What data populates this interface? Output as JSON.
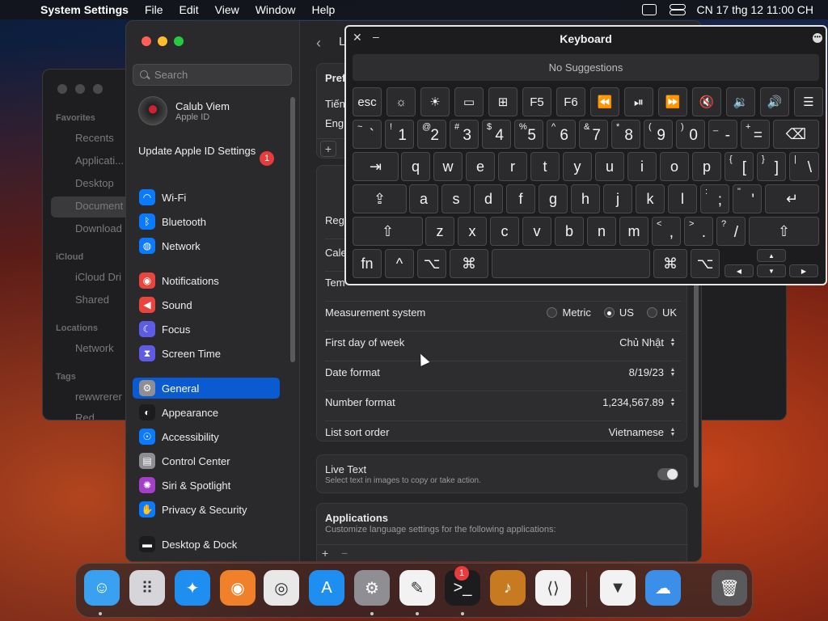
{
  "menubar": {
    "app_name": "System Settings",
    "menus": [
      "File",
      "Edit",
      "View",
      "Window",
      "Help"
    ],
    "clock": "CN 17 thg 12  11:00 CH"
  },
  "finder": {
    "favorites_label": "Favorites",
    "favorites": [
      "Recents",
      "Applicati...",
      "Desktop",
      "Document",
      "Download"
    ],
    "icloud_label": "iCloud",
    "icloud": [
      "iCloud Dri",
      "Shared"
    ],
    "locations_label": "Locations",
    "locations": [
      "Network"
    ],
    "tags_label": "Tags",
    "tags": [
      "rewwrerer",
      "Red"
    ]
  },
  "sidebar": {
    "search_placeholder": "Search",
    "user_name": "Calub Viem",
    "user_sub": "Apple ID",
    "update_label": "Update Apple ID Settings",
    "update_badge": "1",
    "items": [
      {
        "label": "Wi-Fi",
        "icon": "wifi-icon",
        "color": "#0a7aff"
      },
      {
        "label": "Bluetooth",
        "icon": "bluetooth-icon",
        "color": "#0a7aff"
      },
      {
        "label": "Network",
        "icon": "globe-icon",
        "color": "#0a7aff"
      },
      {
        "label": "Notifications",
        "icon": "bell-icon",
        "color": "#e8453c"
      },
      {
        "label": "Sound",
        "icon": "speaker-icon",
        "color": "#e8453c"
      },
      {
        "label": "Focus",
        "icon": "moon-icon",
        "color": "#5e5ce6"
      },
      {
        "label": "Screen Time",
        "icon": "hourglass-icon",
        "color": "#5e5ce6"
      },
      {
        "label": "General",
        "icon": "gear-icon",
        "color": "#8e8e93"
      },
      {
        "label": "Appearance",
        "icon": "appearance-icon",
        "color": "#1c1c1e"
      },
      {
        "label": "Accessibility",
        "icon": "accessibility-icon",
        "color": "#0a7aff"
      },
      {
        "label": "Control Center",
        "icon": "control-center-icon",
        "color": "#8e8e93"
      },
      {
        "label": "Siri & Spotlight",
        "icon": "siri-icon",
        "color": "#a440c8"
      },
      {
        "label": "Privacy & Security",
        "icon": "hand-icon",
        "color": "#0a7aff"
      },
      {
        "label": "Desktop & Dock",
        "icon": "dock-icon",
        "color": "#1c1c1e"
      }
    ]
  },
  "content": {
    "pref_header": "Pref",
    "lang_rows": [
      "Tiến",
      "Engl"
    ],
    "partial_rows": [
      "Regi",
      "Cale",
      "Tem"
    ],
    "measurement_label": "Measurement system",
    "measurement_options": [
      "Metric",
      "US",
      "UK"
    ],
    "measurement_selected": "US",
    "first_day_label": "First day of week",
    "first_day_value": "Chủ Nhật",
    "date_format_label": "Date format",
    "date_format_value": "8/19/23",
    "number_format_label": "Number format",
    "number_format_value": "1,234,567.89",
    "sort_order_label": "List sort order",
    "sort_order_value": "Vietnamese",
    "live_text_label": "Live Text",
    "live_text_desc": "Select text in images to copy or take action.",
    "apps_label": "Applications",
    "apps_desc": "Customize language settings for the following applications:",
    "plus": "+",
    "minus": "−",
    "back_letter": "L"
  },
  "keyboard": {
    "title": "Keyboard",
    "suggestions": "No Suggestions",
    "row0": [
      "esc",
      "☼",
      "☀",
      "▭",
      "⊞",
      "F5",
      "F6",
      "⏪",
      "⏯",
      "⏩",
      "🔇",
      "🔉",
      "🔊",
      "☰"
    ],
    "row1": [
      {
        "top": "~",
        "main": "`"
      },
      {
        "top": "!",
        "main": "1"
      },
      {
        "top": "@",
        "main": "2"
      },
      {
        "top": "#",
        "main": "3"
      },
      {
        "top": "$",
        "main": "4"
      },
      {
        "top": "%",
        "main": "5"
      },
      {
        "top": "^",
        "main": "6"
      },
      {
        "top": "&",
        "main": "7"
      },
      {
        "top": "*",
        "main": "8"
      },
      {
        "top": "(",
        "main": "9"
      },
      {
        "top": ")",
        "main": "0"
      },
      {
        "top": "_",
        "main": "-"
      },
      {
        "top": "+",
        "main": "="
      }
    ],
    "delete": "⌫",
    "tab": "⇥",
    "row2": [
      "q",
      "w",
      "e",
      "r",
      "t",
      "y",
      "u",
      "i",
      "o",
      "p"
    ],
    "row2_extra": [
      {
        "top": "{",
        "main": "["
      },
      {
        "top": "}",
        "main": "]"
      },
      {
        "top": "|",
        "main": "\\"
      }
    ],
    "caps": "⇪",
    "row3": [
      "a",
      "s",
      "d",
      "f",
      "g",
      "h",
      "j",
      "k",
      "l"
    ],
    "row3_extra": [
      {
        "top": ":",
        "main": ";"
      },
      {
        "top": "\"",
        "main": "'"
      }
    ],
    "return": "↵",
    "shift": "⇧",
    "row4": [
      "z",
      "x",
      "c",
      "v",
      "b",
      "n",
      "m"
    ],
    "row4_extra": [
      {
        "top": "<",
        "main": ","
      },
      {
        "top": ">",
        "main": "."
      },
      {
        "top": "?",
        "main": "/"
      }
    ],
    "fn": "fn",
    "ctrl": "^",
    "option": "⌥",
    "cmd": "⌘",
    "arrow_up": "▲",
    "arrow_down": "▼",
    "arrow_left": "◀",
    "arrow_right": "▶"
  },
  "dock": {
    "settings_badge": "1",
    "apps": [
      {
        "name": "finder",
        "color": "#3aa0f0",
        "glyph": "☺"
      },
      {
        "name": "launchpad",
        "color": "#d6d6da",
        "glyph": "⠿"
      },
      {
        "name": "safari",
        "color": "#1e8ff0",
        "glyph": "✦"
      },
      {
        "name": "firefox",
        "color": "#f0802a",
        "glyph": "◉"
      },
      {
        "name": "chrome",
        "color": "#e8e8e8",
        "glyph": "◎"
      },
      {
        "name": "app-store",
        "color": "#1e8ff0",
        "glyph": "A"
      },
      {
        "name": "system-settings",
        "color": "#8e8e93",
        "glyph": "⚙"
      },
      {
        "name": "textedit",
        "color": "#f2f2f2",
        "glyph": "✎"
      },
      {
        "name": "terminal",
        "color": "#1c1c1e",
        "glyph": ">_"
      },
      {
        "name": "instruments",
        "color": "#c87a20",
        "glyph": "♪"
      },
      {
        "name": "vscode",
        "color": "#f2f2f2",
        "glyph": "⟨⟩"
      },
      {
        "name": "visual-studio",
        "color": "#f2f2f2",
        "glyph": "▼"
      },
      {
        "name": "weather",
        "color": "#3b8fe8",
        "glyph": "☁"
      },
      {
        "name": "trash",
        "color": "#5a5a5c",
        "glyph": "🗑"
      }
    ]
  }
}
